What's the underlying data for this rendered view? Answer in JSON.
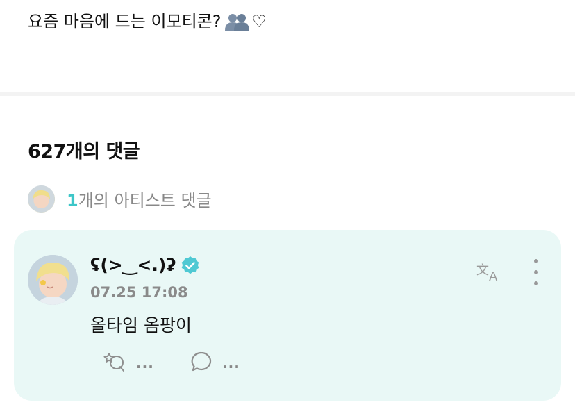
{
  "post": {
    "text": "요즘 마음에 드는 이모티콘?",
    "emoji_icon": "busts-in-silhouette-icon",
    "heart": "♡"
  },
  "comments_header": {
    "count_label": "627개의 댓글"
  },
  "artist_comments": {
    "count": "1",
    "label": "개의 아티스트 댓글"
  },
  "comment": {
    "author": "ʢ(>‿<.)ʡ",
    "verified_icon": "verified-badge-icon",
    "timestamp": "07.25 17:08",
    "body": "올타임 옴팡이",
    "like_count": "...",
    "reply_count": "...",
    "accent_color": "#4fc9d3",
    "card_color": "#e9f8f6"
  }
}
